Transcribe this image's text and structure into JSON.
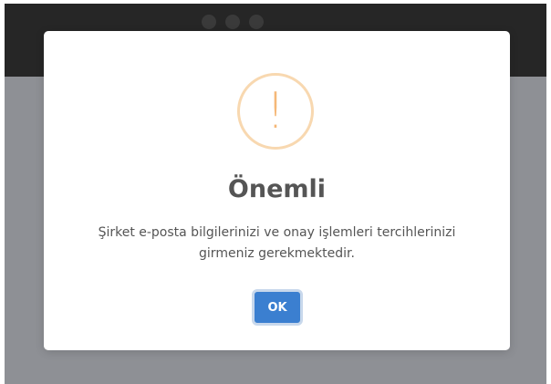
{
  "dialog": {
    "title": "Önemli",
    "message": "Şirket e-posta bilgilerinizi ve onay işlemleri tercihlerinizi girmeniz gerekmektedir.",
    "icon": "exclamation-icon",
    "icon_symbol": "!",
    "ok_label": "OK"
  },
  "colors": {
    "accent": "#3b7fd0",
    "warning": "#f5b878",
    "backdrop": "#8e9095",
    "header": "#262626"
  }
}
